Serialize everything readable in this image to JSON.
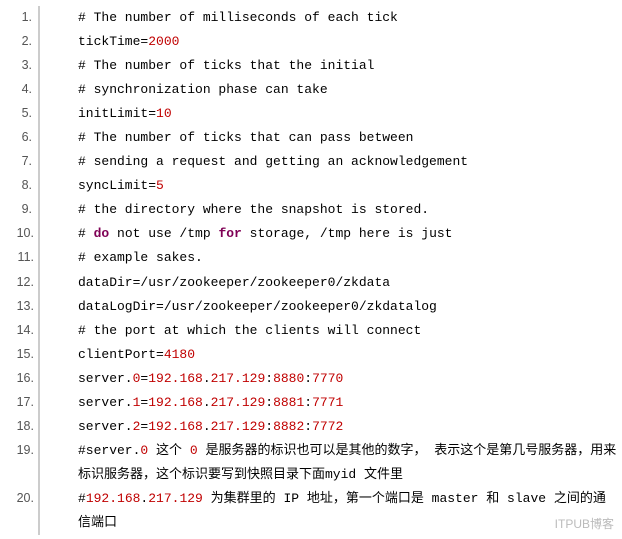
{
  "watermark": "ITPUB博客",
  "code": {
    "lines": [
      {
        "n": "1",
        "tokens": [
          {
            "t": "# The number of milliseconds of each tick"
          }
        ]
      },
      {
        "n": "2",
        "tokens": [
          {
            "t": "tickTime="
          },
          {
            "t": "2000",
            "c": "tok-num"
          }
        ]
      },
      {
        "n": "3",
        "tokens": [
          {
            "t": "# The number of ticks that the initial"
          }
        ]
      },
      {
        "n": "4",
        "tokens": [
          {
            "t": "# synchronization phase can take"
          }
        ]
      },
      {
        "n": "5",
        "tokens": [
          {
            "t": "initLimit="
          },
          {
            "t": "10",
            "c": "tok-num"
          }
        ]
      },
      {
        "n": "6",
        "tokens": [
          {
            "t": "# The number of ticks that can pass between"
          }
        ]
      },
      {
        "n": "7",
        "tokens": [
          {
            "t": "# sending a request and getting an acknowledgement"
          }
        ]
      },
      {
        "n": "8",
        "tokens": [
          {
            "t": "syncLimit="
          },
          {
            "t": "5",
            "c": "tok-num"
          }
        ]
      },
      {
        "n": "9",
        "tokens": [
          {
            "t": "# the directory where the snapshot is stored."
          }
        ]
      },
      {
        "n": "10",
        "tokens": [
          {
            "t": "# "
          },
          {
            "t": "do",
            "c": "tok-kw"
          },
          {
            "t": " not use /tmp "
          },
          {
            "t": "for",
            "c": "tok-kw"
          },
          {
            "t": " storage, /tmp here is just"
          }
        ]
      },
      {
        "n": "11",
        "tokens": [
          {
            "t": "# example sakes."
          }
        ]
      },
      {
        "n": "12",
        "tokens": [
          {
            "t": "dataDir=/usr/zookeeper/zookeeper0/zkdata"
          }
        ]
      },
      {
        "n": "13",
        "tokens": [
          {
            "t": "dataLogDir=/usr/zookeeper/zookeeper0/zkdatalog"
          }
        ]
      },
      {
        "n": "14",
        "tokens": [
          {
            "t": "# the port at which the clients will connect"
          }
        ]
      },
      {
        "n": "15",
        "tokens": [
          {
            "t": "clientPort="
          },
          {
            "t": "4180",
            "c": "tok-num"
          }
        ]
      },
      {
        "n": "16",
        "tokens": [
          {
            "t": "server."
          },
          {
            "t": "0",
            "c": "tok-num"
          },
          {
            "t": "="
          },
          {
            "t": "192.168",
            "c": "tok-num"
          },
          {
            "t": "."
          },
          {
            "t": "217.129",
            "c": "tok-num"
          },
          {
            "t": ":"
          },
          {
            "t": "8880",
            "c": "tok-num"
          },
          {
            "t": ":"
          },
          {
            "t": "7770",
            "c": "tok-num"
          }
        ]
      },
      {
        "n": "17",
        "tokens": [
          {
            "t": "server."
          },
          {
            "t": "1",
            "c": "tok-num"
          },
          {
            "t": "="
          },
          {
            "t": "192.168",
            "c": "tok-num"
          },
          {
            "t": "."
          },
          {
            "t": "217.129",
            "c": "tok-num"
          },
          {
            "t": ":"
          },
          {
            "t": "8881",
            "c": "tok-num"
          },
          {
            "t": ":"
          },
          {
            "t": "7771",
            "c": "tok-num"
          }
        ]
      },
      {
        "n": "18",
        "tokens": [
          {
            "t": "server."
          },
          {
            "t": "2",
            "c": "tok-num"
          },
          {
            "t": "="
          },
          {
            "t": "192.168",
            "c": "tok-num"
          },
          {
            "t": "."
          },
          {
            "t": "217.129",
            "c": "tok-num"
          },
          {
            "t": ":"
          },
          {
            "t": "8882",
            "c": "tok-num"
          },
          {
            "t": ":"
          },
          {
            "t": "7772",
            "c": "tok-num"
          }
        ]
      },
      {
        "n": "19",
        "tokens": [
          {
            "t": "#server."
          },
          {
            "t": "0",
            "c": "tok-num"
          },
          {
            "t": " 这个 "
          },
          {
            "t": "0",
            "c": "tok-num"
          },
          {
            "t": " 是服务器的标识也可以是其他的数字， 表示这个是第几号服务器，用来标识服务器，这个标识要写到快照目录下面myid 文件里"
          }
        ]
      },
      {
        "n": "20",
        "tokens": [
          {
            "t": "#"
          },
          {
            "t": "192.168",
            "c": "tok-num"
          },
          {
            "t": "."
          },
          {
            "t": "217.129",
            "c": "tok-num"
          },
          {
            "t": " 为集群里的 IP 地址，第一个端口是 master 和 slave 之间的通信端口"
          }
        ]
      }
    ]
  }
}
